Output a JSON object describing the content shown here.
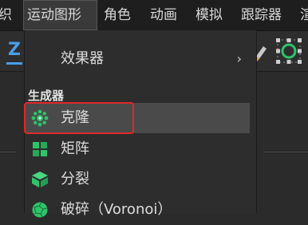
{
  "menubar": {
    "items": [
      {
        "label": "织",
        "active": false
      },
      {
        "label": "运动图形",
        "active": true
      },
      {
        "label": "角色",
        "active": false
      },
      {
        "label": "动画",
        "active": false
      },
      {
        "label": "模拟",
        "active": false
      },
      {
        "label": "跟踪器",
        "active": false
      },
      {
        "label": "渲",
        "active": false
      }
    ]
  },
  "toolbar": {
    "left_label": "Z"
  },
  "dropdown": {
    "effector_item": {
      "label": "效果器",
      "arrow": "›",
      "icon": "none"
    },
    "section_header": "生成器",
    "items": [
      {
        "label": "克隆",
        "icon": "cloner-icon",
        "highlighted": true,
        "selected_box": true
      },
      {
        "label": "矩阵",
        "icon": "matrix-icon",
        "highlighted": false
      },
      {
        "label": "分裂",
        "icon": "fracture-icon",
        "highlighted": false
      },
      {
        "label": "破碎（Voronoi）",
        "icon": "voronoi-icon",
        "highlighted": false
      }
    ]
  },
  "colors": {
    "accent_green": "#2ec46a",
    "highlight_row": "#4a4a4a",
    "selection_box": "#e02828",
    "z_axis_blue": "#4a9ee8"
  }
}
